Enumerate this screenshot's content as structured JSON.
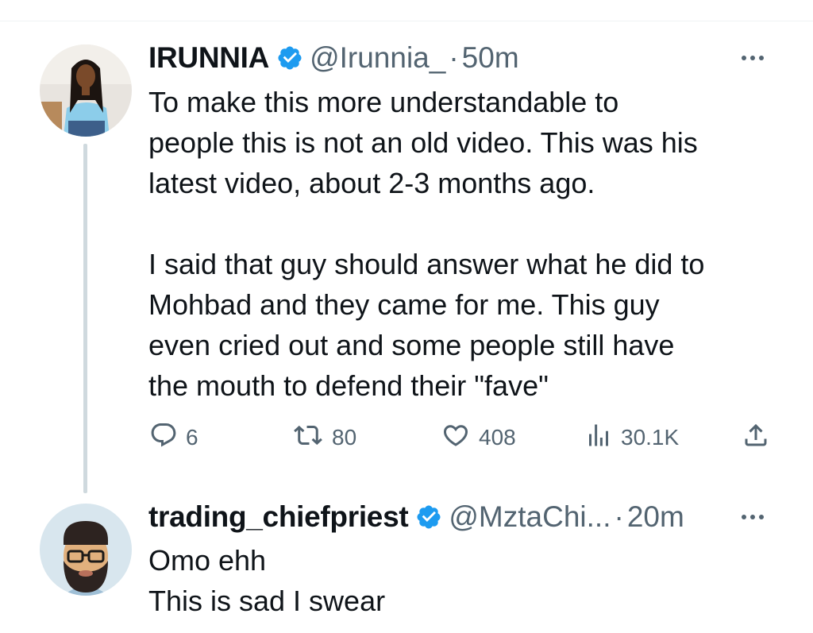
{
  "tweet1": {
    "display_name": "IRUNNIA",
    "handle": "@Irunnia_",
    "dot": "·",
    "time": "50m",
    "lines_p1": [
      "To make this more understandable to",
      "people this is not an old video. This was his",
      "latest video, about 2-3 months ago."
    ],
    "lines_p2": [
      "I said that guy should answer what he did to",
      "Mohbad and they came for me. This guy",
      "even cried out and some people still have",
      "the mouth to defend their \"fave\""
    ],
    "actions": {
      "replies": "6",
      "reposts": "80",
      "likes": "408",
      "views": "30.1K"
    }
  },
  "tweet2": {
    "display_name": "trading_chiefpriest",
    "handle": "@MztaChi...",
    "dot": "·",
    "time": "20m",
    "lines": [
      "Omo ehh",
      "This is sad I swear"
    ]
  },
  "icons": [
    "verified-badge-icon",
    "more-icon",
    "reply-icon",
    "repost-icon",
    "like-icon",
    "views-icon",
    "share-icon"
  ],
  "colors": {
    "verified": "#1d9bf0",
    "secondary_text": "#536471",
    "thread_line": "#cfd9de",
    "text": "#0f1419"
  }
}
